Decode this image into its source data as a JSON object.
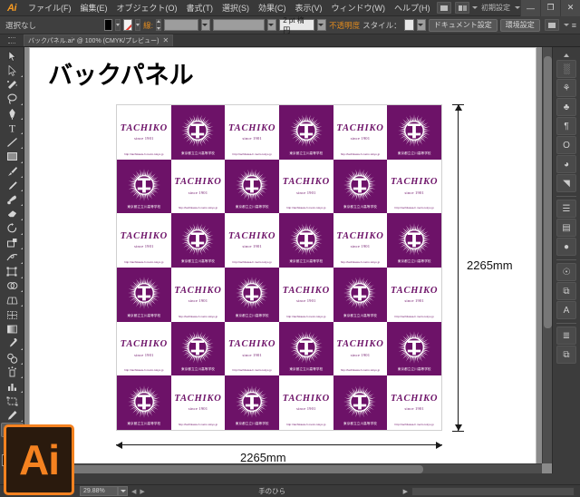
{
  "app": {
    "name": "Ai",
    "logo_text": "Ai"
  },
  "menubar": {
    "items": [
      {
        "label": "ファイル(F)"
      },
      {
        "label": "編集(E)"
      },
      {
        "label": "オブジェクト(O)"
      },
      {
        "label": "書式(T)"
      },
      {
        "label": "選択(S)"
      },
      {
        "label": "効果(C)"
      },
      {
        "label": "表示(V)"
      },
      {
        "label": "ウィンドウ(W)"
      },
      {
        "label": "ヘルプ(H)"
      }
    ],
    "workspace_label": "初期設定",
    "window_buttons": {
      "minimize": "—",
      "maximize": "❐",
      "close": "✕"
    }
  },
  "controlbar": {
    "selection_status": "選択なし",
    "stroke_label": "線:",
    "stroke_weight": "2 pt 楕円",
    "opacity_label": "不透明度",
    "style_label": "スタイル：",
    "document_setup_button": "ドキュメント設定",
    "preferences_button": "環境設定"
  },
  "tabbar": {
    "document_title": "バックパネル.ai* @ 100% (CMYK/プレビュー)",
    "close_glyph": "✕"
  },
  "toolbar": {
    "tools": [
      {
        "name": "selection-tool",
        "selected": false
      },
      {
        "name": "direct-selection-tool",
        "selected": false
      },
      {
        "name": "magic-wand-tool",
        "selected": false
      },
      {
        "name": "lasso-tool",
        "selected": false
      },
      {
        "name": "pen-tool",
        "selected": false
      },
      {
        "name": "type-tool",
        "selected": false
      },
      {
        "name": "line-segment-tool",
        "selected": false
      },
      {
        "name": "rectangle-tool",
        "selected": false
      },
      {
        "name": "paintbrush-tool",
        "selected": false
      },
      {
        "name": "pencil-tool",
        "selected": false
      },
      {
        "name": "blob-brush-tool",
        "selected": false
      },
      {
        "name": "eraser-tool",
        "selected": false
      },
      {
        "name": "rotate-tool",
        "selected": false
      },
      {
        "name": "scale-tool",
        "selected": false
      },
      {
        "name": "width-tool",
        "selected": false
      },
      {
        "name": "free-transform-tool",
        "selected": false
      },
      {
        "name": "shape-builder-tool",
        "selected": false
      },
      {
        "name": "perspective-grid-tool",
        "selected": false
      },
      {
        "name": "mesh-tool",
        "selected": false
      },
      {
        "name": "gradient-tool",
        "selected": false
      },
      {
        "name": "eyedropper-tool",
        "selected": false
      },
      {
        "name": "blend-tool",
        "selected": false
      },
      {
        "name": "symbol-sprayer-tool",
        "selected": false
      },
      {
        "name": "column-graph-tool",
        "selected": false
      },
      {
        "name": "artboard-tool",
        "selected": false
      },
      {
        "name": "slice-tool",
        "selected": false
      },
      {
        "name": "hand-tool",
        "selected": true
      },
      {
        "name": "zoom-tool",
        "selected": false
      }
    ]
  },
  "artboard": {
    "title": "バックパネル",
    "pattern": {
      "rows": 6,
      "columns": 6,
      "white_tile": {
        "brand": "TACHIKO",
        "since": "since 1901",
        "url": "http://tachikawa-h.metro.tokyo.jp"
      },
      "purple_tile": {
        "school_name": "東京都立立川高等学校"
      },
      "colors": {
        "purple": "#6d1268",
        "white": "#ffffff"
      }
    },
    "dimensions": {
      "width_label": "2265mm",
      "height_label": "2265mm"
    }
  },
  "statusbar": {
    "zoom_level": "29.88%",
    "current_tool": "手のひら",
    "prev_glyph": "◀",
    "next_glyph": "▶",
    "expand_glyph": "▶"
  },
  "dock": {
    "icons": [
      {
        "name": "color-panel-icon",
        "glyph": "░"
      },
      {
        "name": "color-guide-icon",
        "glyph": "⚘"
      },
      {
        "name": "swatches-panel-icon",
        "glyph": "♣"
      },
      {
        "name": "paragraph-panel-icon",
        "glyph": "¶"
      },
      {
        "name": "character-panel-icon",
        "glyph": "O"
      },
      {
        "name": "brushes-panel-icon",
        "glyph": "◕"
      },
      {
        "name": "gradient-panel-icon",
        "glyph": "◥"
      },
      {
        "name": "align-panel-icon",
        "glyph": "☰"
      },
      {
        "name": "transparency-panel-icon",
        "glyph": "▤"
      },
      {
        "name": "appearance-panel-icon",
        "glyph": "●"
      },
      {
        "name": "symbols-panel-icon",
        "glyph": "☉"
      },
      {
        "name": "graphic-styles-panel-icon",
        "glyph": "⧉"
      },
      {
        "name": "type-panel-icon",
        "glyph": "A"
      },
      {
        "name": "layers-panel-icon",
        "glyph": "≣"
      },
      {
        "name": "artboards-panel-icon",
        "glyph": "⧉"
      }
    ]
  }
}
